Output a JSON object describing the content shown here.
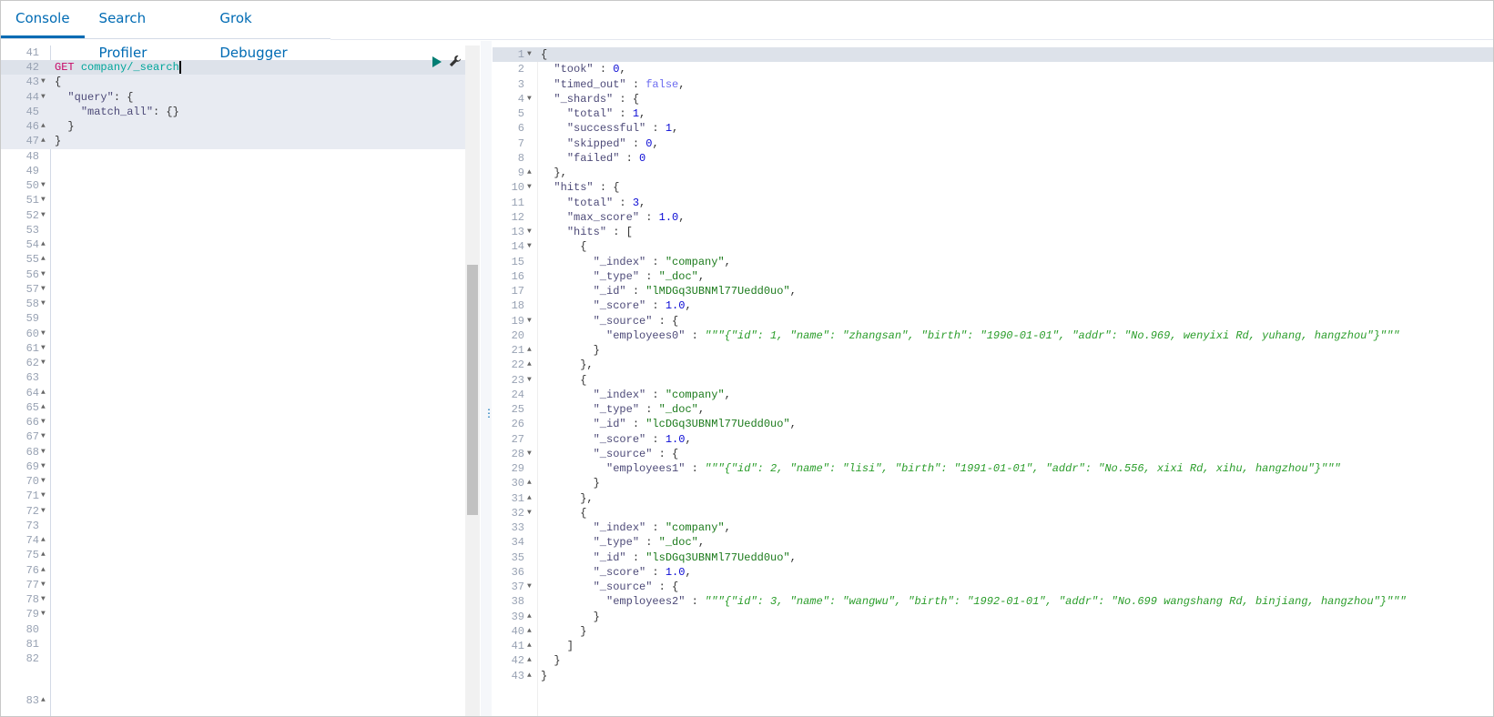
{
  "tabs": [
    {
      "label": "Console",
      "active": true
    },
    {
      "label": "Search Profiler",
      "active": false
    },
    {
      "label": "Grok Debugger",
      "active": false
    }
  ],
  "colors": {
    "accent": "#006bb4",
    "method": "#c80a68",
    "url": "#00a69b",
    "string": "#1b7a1b",
    "number": "#0a0ad4",
    "run": "#017d73"
  },
  "icons": {
    "run": "play-icon",
    "settings": "wrench-icon",
    "resize": "vertical-dots-icon"
  },
  "request_editor": {
    "first_line": 41,
    "lines": [
      {
        "n": "41",
        "fold": "",
        "tokens": []
      },
      {
        "n": "42",
        "fold": "",
        "tokens": [
          [
            "method",
            "GET"
          ],
          [
            "punc",
            " "
          ],
          [
            "url",
            "company/_search"
          ]
        ],
        "active": true
      },
      {
        "n": "43",
        "fold": "open",
        "tokens": [
          [
            "punc",
            "{"
          ]
        ],
        "block": true
      },
      {
        "n": "44",
        "fold": "open",
        "tokens": [
          [
            "punc",
            "  "
          ],
          [
            "key",
            "\"query\""
          ],
          [
            "punc",
            ": {"
          ]
        ],
        "block": true
      },
      {
        "n": "45",
        "fold": "",
        "tokens": [
          [
            "punc",
            "    "
          ],
          [
            "key",
            "\"match_all\""
          ],
          [
            "punc",
            ": {}"
          ]
        ],
        "block": true
      },
      {
        "n": "46",
        "fold": "close",
        "tokens": [
          [
            "punc",
            "  }"
          ]
        ],
        "block": true
      },
      {
        "n": "47",
        "fold": "close",
        "tokens": [
          [
            "punc",
            "}"
          ]
        ],
        "block": true
      },
      {
        "n": "48",
        "fold": ""
      },
      {
        "n": "49",
        "fold": ""
      },
      {
        "n": "50",
        "fold": "open"
      },
      {
        "n": "51",
        "fold": "open"
      },
      {
        "n": "52",
        "fold": "open"
      },
      {
        "n": "53",
        "fold": ""
      },
      {
        "n": "54",
        "fold": "close"
      },
      {
        "n": "55",
        "fold": "close"
      },
      {
        "n": "56",
        "fold": "open"
      },
      {
        "n": "57",
        "fold": "open"
      },
      {
        "n": "58",
        "fold": "open"
      },
      {
        "n": "59",
        "fold": ""
      },
      {
        "n": "60",
        "fold": "open"
      },
      {
        "n": "61",
        "fold": "open"
      },
      {
        "n": "62",
        "fold": "open"
      },
      {
        "n": "63",
        "fold": ""
      },
      {
        "n": "64",
        "fold": "close"
      },
      {
        "n": "65",
        "fold": "close"
      },
      {
        "n": "66",
        "fold": "open"
      },
      {
        "n": "67",
        "fold": "open"
      },
      {
        "n": "68",
        "fold": "open"
      },
      {
        "n": "69",
        "fold": "open"
      },
      {
        "n": "70",
        "fold": "open"
      },
      {
        "n": "71",
        "fold": "open"
      },
      {
        "n": "72",
        "fold": "open"
      },
      {
        "n": "73",
        "fold": ""
      },
      {
        "n": "74",
        "fold": "close"
      },
      {
        "n": "75",
        "fold": "close"
      },
      {
        "n": "76",
        "fold": "close"
      },
      {
        "n": "77",
        "fold": "open"
      },
      {
        "n": "78",
        "fold": "open"
      },
      {
        "n": "79",
        "fold": "open"
      },
      {
        "n": "80",
        "fold": ""
      },
      {
        "n": "81",
        "fold": ""
      },
      {
        "n": "82",
        "fold": ""
      },
      {
        "n": "",
        "fold": ""
      },
      {
        "n": "83",
        "fold": "close"
      }
    ]
  },
  "response": {
    "lines": [
      {
        "fold": "open",
        "tokens": [
          [
            "punc",
            "{"
          ]
        ]
      },
      {
        "tokens": [
          [
            "punc",
            "  "
          ],
          [
            "key",
            "\"took\""
          ],
          [
            "punc",
            " : "
          ],
          [
            "num",
            "0"
          ],
          [
            "punc",
            ","
          ]
        ]
      },
      {
        "tokens": [
          [
            "punc",
            "  "
          ],
          [
            "key",
            "\"timed_out\""
          ],
          [
            "punc",
            " : "
          ],
          [
            "bool",
            "false"
          ],
          [
            "punc",
            ","
          ]
        ]
      },
      {
        "fold": "open",
        "tokens": [
          [
            "punc",
            "  "
          ],
          [
            "key",
            "\"_shards\""
          ],
          [
            "punc",
            " : {"
          ]
        ]
      },
      {
        "tokens": [
          [
            "punc",
            "    "
          ],
          [
            "key",
            "\"total\""
          ],
          [
            "punc",
            " : "
          ],
          [
            "num",
            "1"
          ],
          [
            "punc",
            ","
          ]
        ]
      },
      {
        "tokens": [
          [
            "punc",
            "    "
          ],
          [
            "key",
            "\"successful\""
          ],
          [
            "punc",
            " : "
          ],
          [
            "num",
            "1"
          ],
          [
            "punc",
            ","
          ]
        ]
      },
      {
        "tokens": [
          [
            "punc",
            "    "
          ],
          [
            "key",
            "\"skipped\""
          ],
          [
            "punc",
            " : "
          ],
          [
            "num",
            "0"
          ],
          [
            "punc",
            ","
          ]
        ]
      },
      {
        "tokens": [
          [
            "punc",
            "    "
          ],
          [
            "key",
            "\"failed\""
          ],
          [
            "punc",
            " : "
          ],
          [
            "num",
            "0"
          ]
        ]
      },
      {
        "fold": "close",
        "tokens": [
          [
            "punc",
            "  },"
          ]
        ]
      },
      {
        "fold": "open",
        "tokens": [
          [
            "punc",
            "  "
          ],
          [
            "key",
            "\"hits\""
          ],
          [
            "punc",
            " : {"
          ]
        ]
      },
      {
        "tokens": [
          [
            "punc",
            "    "
          ],
          [
            "key",
            "\"total\""
          ],
          [
            "punc",
            " : "
          ],
          [
            "num",
            "3"
          ],
          [
            "punc",
            ","
          ]
        ]
      },
      {
        "tokens": [
          [
            "punc",
            "    "
          ],
          [
            "key",
            "\"max_score\""
          ],
          [
            "punc",
            " : "
          ],
          [
            "num",
            "1.0"
          ],
          [
            "punc",
            ","
          ]
        ]
      },
      {
        "fold": "open",
        "tokens": [
          [
            "punc",
            "    "
          ],
          [
            "key",
            "\"hits\""
          ],
          [
            "punc",
            " : ["
          ]
        ]
      },
      {
        "fold": "open",
        "tokens": [
          [
            "punc",
            "      {"
          ]
        ]
      },
      {
        "tokens": [
          [
            "punc",
            "        "
          ],
          [
            "key",
            "\"_index\""
          ],
          [
            "punc",
            " : "
          ],
          [
            "str",
            "\"company\""
          ],
          [
            "punc",
            ","
          ]
        ]
      },
      {
        "tokens": [
          [
            "punc",
            "        "
          ],
          [
            "key",
            "\"_type\""
          ],
          [
            "punc",
            " : "
          ],
          [
            "str",
            "\"_doc\""
          ],
          [
            "punc",
            ","
          ]
        ]
      },
      {
        "tokens": [
          [
            "punc",
            "        "
          ],
          [
            "key",
            "\"_id\""
          ],
          [
            "punc",
            " : "
          ],
          [
            "str",
            "\"lMDGq3UBNMl77Uedd0uo\""
          ],
          [
            "punc",
            ","
          ]
        ]
      },
      {
        "tokens": [
          [
            "punc",
            "        "
          ],
          [
            "key",
            "\"_score\""
          ],
          [
            "punc",
            " : "
          ],
          [
            "num",
            "1.0"
          ],
          [
            "punc",
            ","
          ]
        ]
      },
      {
        "fold": "open",
        "tokens": [
          [
            "punc",
            "        "
          ],
          [
            "key",
            "\"_source\""
          ],
          [
            "punc",
            " : {"
          ]
        ]
      },
      {
        "tokens": [
          [
            "punc",
            "          "
          ],
          [
            "key",
            "\"employees0\""
          ],
          [
            "punc",
            " : "
          ],
          [
            "triple",
            "\"\"\"{\"id\": 1, \"name\": \"zhangsan\", \"birth\": \"1990-01-01\", \"addr\": \"No.969, wenyixi Rd, yuhang, hangzhou\"}\"\"\""
          ]
        ]
      },
      {
        "fold": "close",
        "tokens": [
          [
            "punc",
            "        }"
          ]
        ]
      },
      {
        "fold": "close",
        "tokens": [
          [
            "punc",
            "      },"
          ]
        ]
      },
      {
        "fold": "open",
        "tokens": [
          [
            "punc",
            "      {"
          ]
        ]
      },
      {
        "tokens": [
          [
            "punc",
            "        "
          ],
          [
            "key",
            "\"_index\""
          ],
          [
            "punc",
            " : "
          ],
          [
            "str",
            "\"company\""
          ],
          [
            "punc",
            ","
          ]
        ]
      },
      {
        "tokens": [
          [
            "punc",
            "        "
          ],
          [
            "key",
            "\"_type\""
          ],
          [
            "punc",
            " : "
          ],
          [
            "str",
            "\"_doc\""
          ],
          [
            "punc",
            ","
          ]
        ]
      },
      {
        "tokens": [
          [
            "punc",
            "        "
          ],
          [
            "key",
            "\"_id\""
          ],
          [
            "punc",
            " : "
          ],
          [
            "str",
            "\"lcDGq3UBNMl77Uedd0uo\""
          ],
          [
            "punc",
            ","
          ]
        ]
      },
      {
        "tokens": [
          [
            "punc",
            "        "
          ],
          [
            "key",
            "\"_score\""
          ],
          [
            "punc",
            " : "
          ],
          [
            "num",
            "1.0"
          ],
          [
            "punc",
            ","
          ]
        ]
      },
      {
        "fold": "open",
        "tokens": [
          [
            "punc",
            "        "
          ],
          [
            "key",
            "\"_source\""
          ],
          [
            "punc",
            " : {"
          ]
        ]
      },
      {
        "tokens": [
          [
            "punc",
            "          "
          ],
          [
            "key",
            "\"employees1\""
          ],
          [
            "punc",
            " : "
          ],
          [
            "triple",
            "\"\"\"{\"id\": 2, \"name\": \"lisi\", \"birth\": \"1991-01-01\", \"addr\": \"No.556, xixi Rd, xihu, hangzhou\"}\"\"\""
          ]
        ]
      },
      {
        "fold": "close",
        "tokens": [
          [
            "punc",
            "        }"
          ]
        ]
      },
      {
        "fold": "close",
        "tokens": [
          [
            "punc",
            "      },"
          ]
        ]
      },
      {
        "fold": "open",
        "tokens": [
          [
            "punc",
            "      {"
          ]
        ]
      },
      {
        "tokens": [
          [
            "punc",
            "        "
          ],
          [
            "key",
            "\"_index\""
          ],
          [
            "punc",
            " : "
          ],
          [
            "str",
            "\"company\""
          ],
          [
            "punc",
            ","
          ]
        ]
      },
      {
        "tokens": [
          [
            "punc",
            "        "
          ],
          [
            "key",
            "\"_type\""
          ],
          [
            "punc",
            " : "
          ],
          [
            "str",
            "\"_doc\""
          ],
          [
            "punc",
            ","
          ]
        ]
      },
      {
        "tokens": [
          [
            "punc",
            "        "
          ],
          [
            "key",
            "\"_id\""
          ],
          [
            "punc",
            " : "
          ],
          [
            "str",
            "\"lsDGq3UBNMl77Uedd0uo\""
          ],
          [
            "punc",
            ","
          ]
        ]
      },
      {
        "tokens": [
          [
            "punc",
            "        "
          ],
          [
            "key",
            "\"_score\""
          ],
          [
            "punc",
            " : "
          ],
          [
            "num",
            "1.0"
          ],
          [
            "punc",
            ","
          ]
        ]
      },
      {
        "fold": "open",
        "tokens": [
          [
            "punc",
            "        "
          ],
          [
            "key",
            "\"_source\""
          ],
          [
            "punc",
            " : {"
          ]
        ]
      },
      {
        "tokens": [
          [
            "punc",
            "          "
          ],
          [
            "key",
            "\"employees2\""
          ],
          [
            "punc",
            " : "
          ],
          [
            "triple",
            "\"\"\"{\"id\": 3, \"name\": \"wangwu\", \"birth\": \"1992-01-01\", \"addr\": \"No.699 wangshang Rd, binjiang, hangzhou\"}\"\"\""
          ]
        ]
      },
      {
        "fold": "close",
        "tokens": [
          [
            "punc",
            "        }"
          ]
        ]
      },
      {
        "fold": "close",
        "tokens": [
          [
            "punc",
            "      }"
          ]
        ]
      },
      {
        "fold": "close",
        "tokens": [
          [
            "punc",
            "    ]"
          ]
        ]
      },
      {
        "fold": "close",
        "tokens": [
          [
            "punc",
            "  }"
          ]
        ]
      },
      {
        "fold": "close",
        "tokens": [
          [
            "punc",
            "}"
          ]
        ]
      }
    ]
  }
}
